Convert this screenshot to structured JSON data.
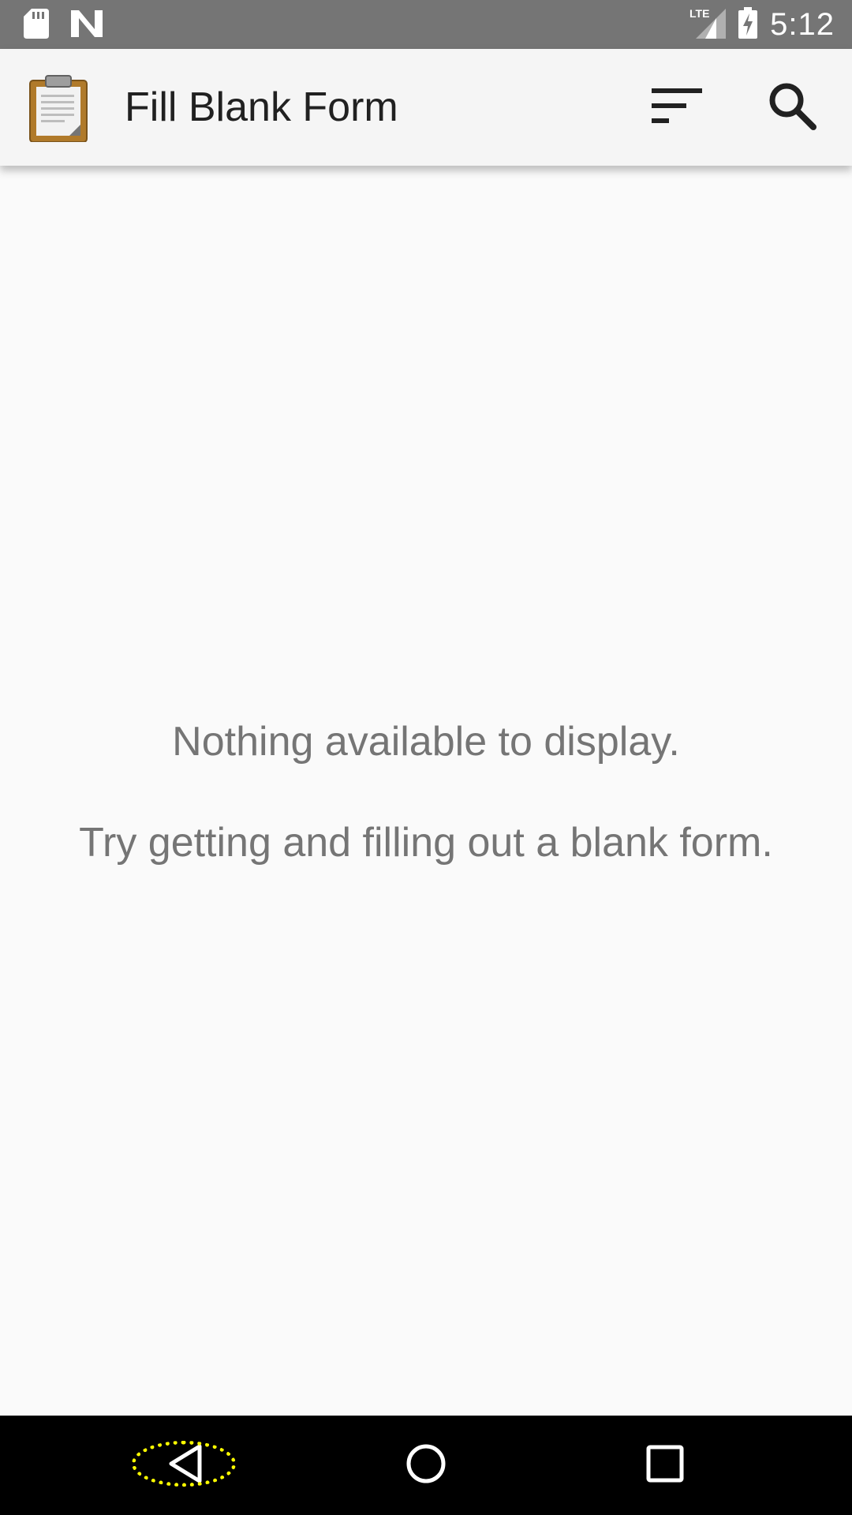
{
  "status_bar": {
    "time": "5:12",
    "network_label": "LTE",
    "icons": [
      "sd-card-icon",
      "n-logo-icon",
      "lte-signal-icon",
      "battery-charging-icon"
    ]
  },
  "app_bar": {
    "title": "Fill Blank Form",
    "app_icon": "clipboard-icon",
    "actions": [
      "sort-icon",
      "search-icon"
    ]
  },
  "empty_state": {
    "line1": "Nothing available to display.",
    "line2": "Try getting and filling out a blank form."
  },
  "nav_bar": {
    "buttons": [
      "back-icon",
      "home-icon",
      "recents-icon"
    ],
    "focused": "back"
  },
  "colors": {
    "status_bar": "#757575",
    "app_bar": "#f5f5f5",
    "background": "#fafafa",
    "title_text": "#212121",
    "empty_text": "#757575",
    "nav_bar": "#000000",
    "focus_ring": "#ffff00"
  }
}
